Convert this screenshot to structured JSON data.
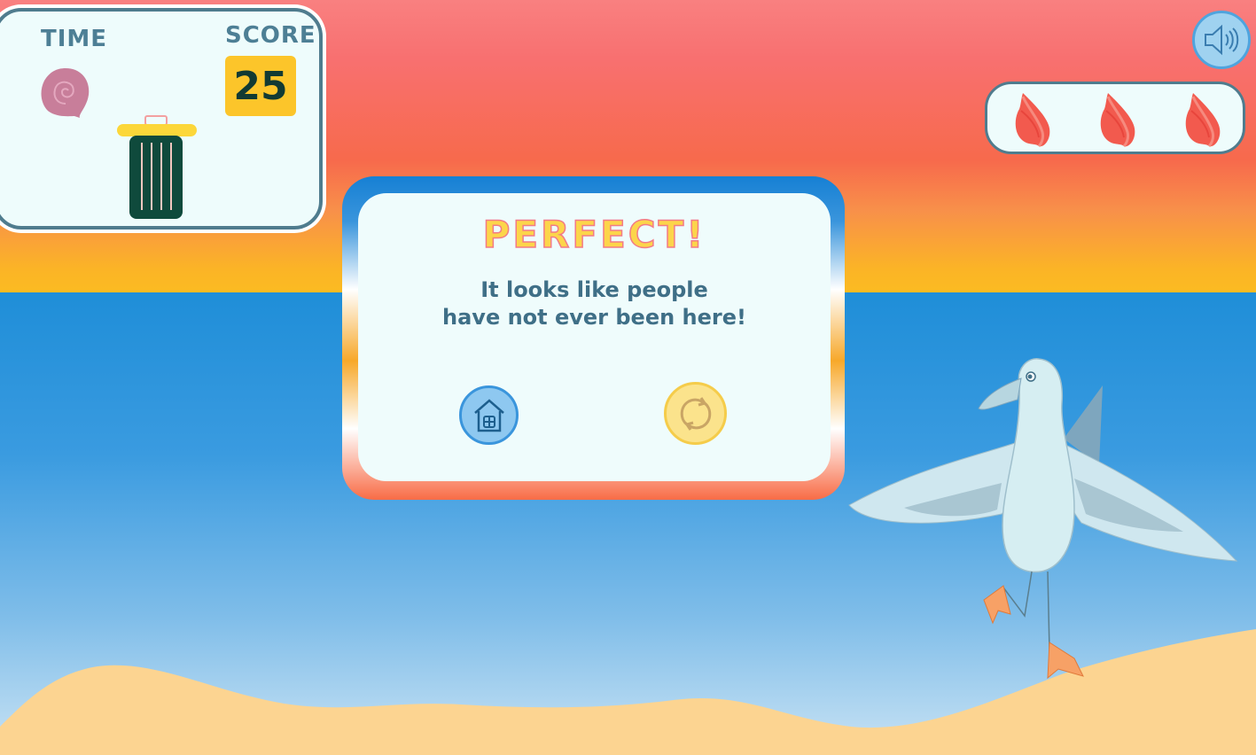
{
  "hud": {
    "time_label": "TIME",
    "score_label": "SCORE",
    "score_value": "25",
    "timer_icon": "snail-shell-icon",
    "bin_icon": "trash-bin-icon"
  },
  "lives": {
    "count": 3,
    "icon": "conch-shell-icon"
  },
  "sound_button": {
    "icon": "speaker-icon"
  },
  "dialog": {
    "title": "PERFECT!",
    "message_line1": "It looks like people",
    "message_line2": "have not ever been here!",
    "home_icon": "home-icon",
    "replay_icon": "replay-icon"
  },
  "colors": {
    "accent_blue": "#1f8ed8",
    "score_yellow": "#fcc52a",
    "title_yellow": "#fcd54a",
    "title_outline": "#f37b86",
    "text_teal": "#3f6f87",
    "bin_green": "#0f4a3c"
  }
}
